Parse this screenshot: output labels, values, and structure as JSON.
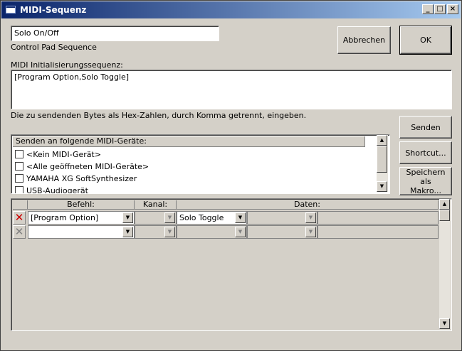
{
  "window": {
    "title": "MIDI-Sequenz",
    "minimize_glyph": "_",
    "maximize_glyph": "□",
    "close_glyph": "×"
  },
  "name_field": {
    "value": "Solo On/Off",
    "caption": "Control Pad Sequence"
  },
  "init_sequence": {
    "label": "MIDI Initialisierungssequenz:",
    "value": "[Program Option,Solo Toggle]",
    "hint": "Die zu sendenden Bytes als Hex-Zahlen, durch Komma getrennt, eingeben."
  },
  "buttons": {
    "cancel": "Abbrechen",
    "ok": "OK",
    "send": "Senden",
    "shortcut": "Shortcut...",
    "save_macro_line1": "Speichern als",
    "save_macro_line2": "Makro..."
  },
  "devices": {
    "header": "Senden an folgende MIDI-Geräte:",
    "items": [
      {
        "label": "<Kein MIDI-Gerät>",
        "checked": false
      },
      {
        "label": "<Alle geöffneten MIDI-Geräte>",
        "checked": false
      },
      {
        "label": "YAMAHA XG SoftSynthesizer",
        "checked": false
      },
      {
        "label": "USB-Audiogerät",
        "checked": false
      }
    ]
  },
  "grid": {
    "columns": {
      "befehl": "Befehl:",
      "kanal": "Kanal:",
      "daten": "Daten:"
    },
    "rows": [
      {
        "befehl": "[Program Option]",
        "kanal": "",
        "daten1": "Solo Toggle",
        "daten2": "",
        "daten3": "",
        "marker_color": "#cc0000"
      },
      {
        "befehl": "",
        "kanal": "",
        "daten1": "",
        "daten2": "",
        "daten3": "",
        "marker_color": "#808080"
      }
    ]
  },
  "glyphs": {
    "arrow_up": "▲",
    "arrow_down": "▼",
    "row_delete": "✕"
  }
}
